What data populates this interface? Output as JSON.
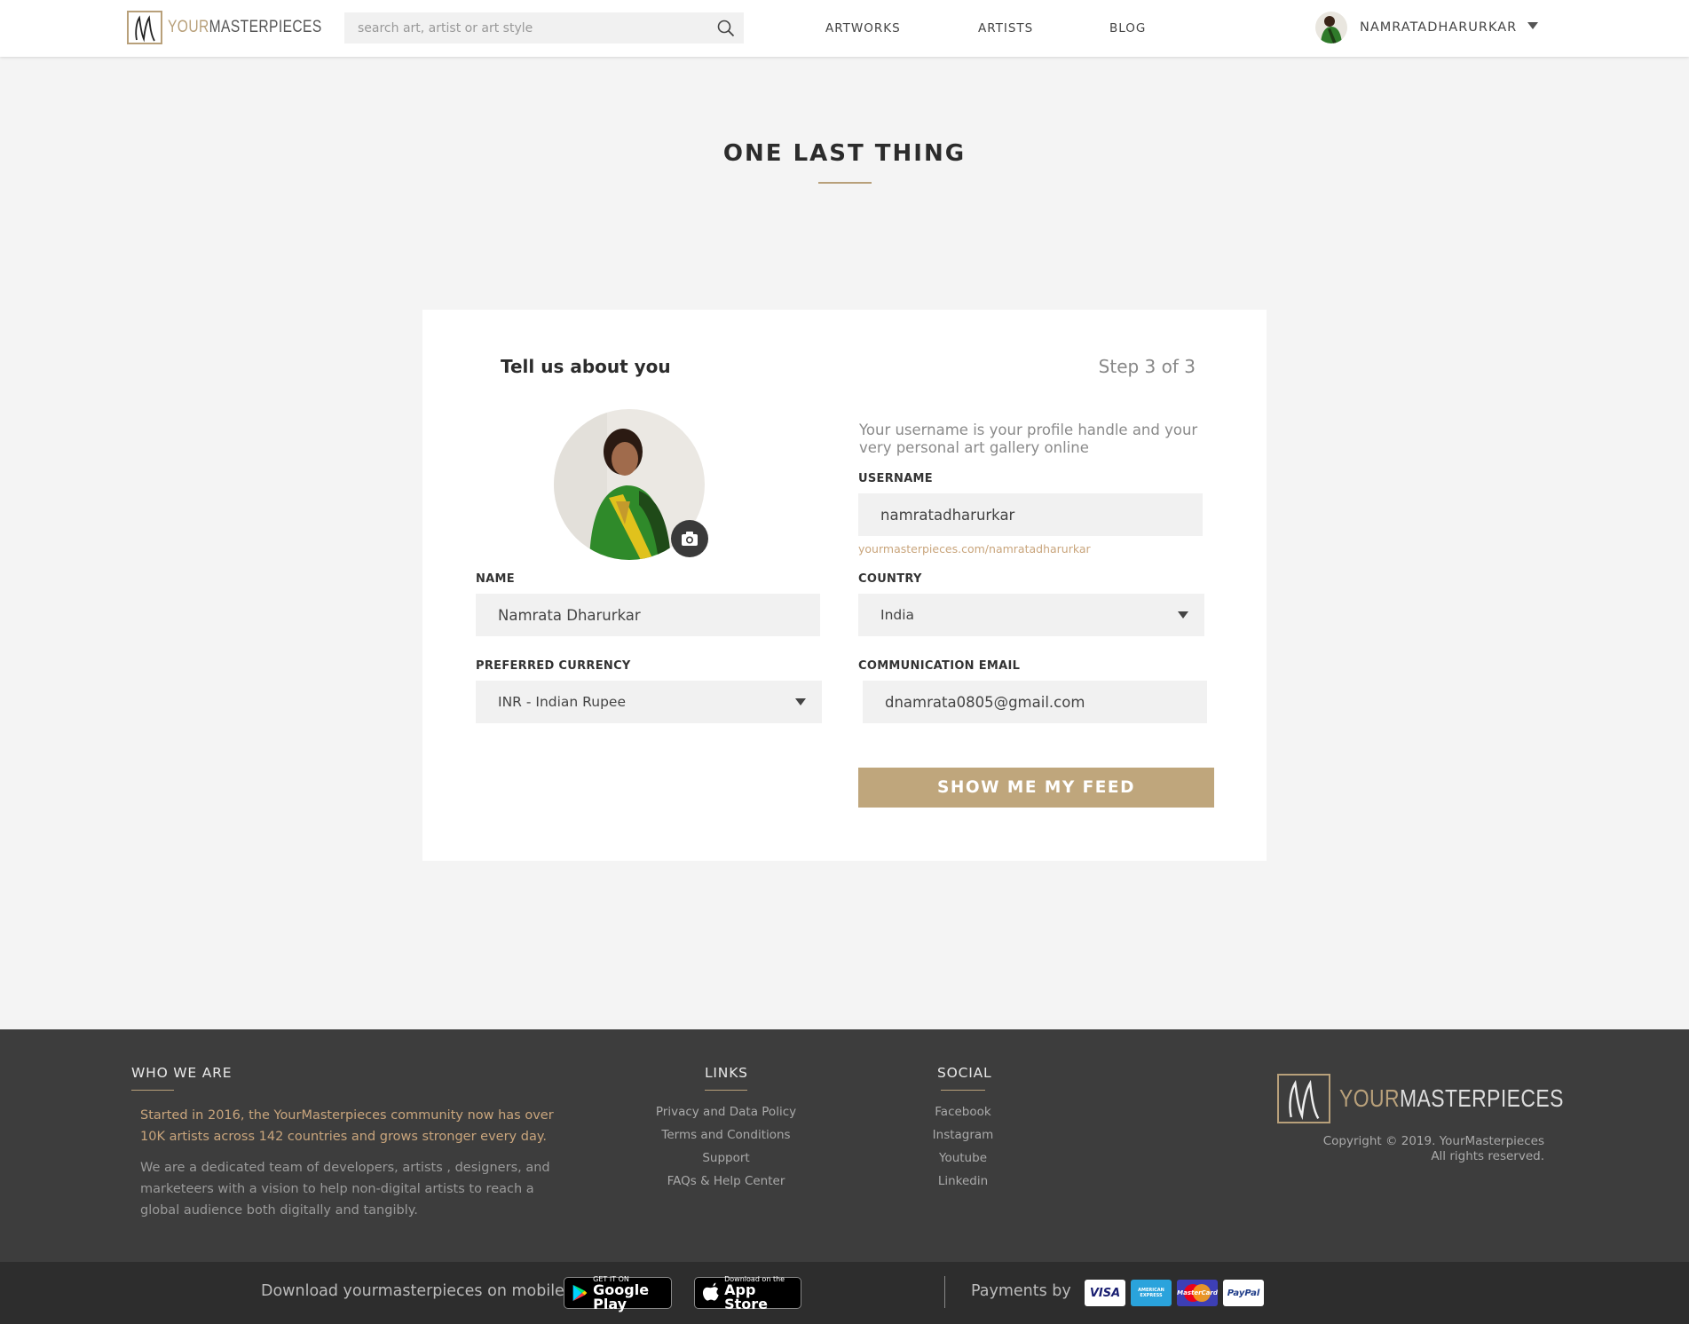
{
  "header": {
    "logo": {
      "your": "YOUR",
      "master": "MASTERPIECES"
    },
    "search_placeholder": "search art, artist or art style",
    "nav": {
      "artworks": "ARTWORKS",
      "artists": "ARTISTS",
      "blog": "BLOG"
    },
    "username": "NAMRATADHARURKAR"
  },
  "page": {
    "title": "ONE LAST THING"
  },
  "card": {
    "heading": "Tell us about you",
    "step": "Step 3 of 3",
    "hint": "Your username is your profile handle and your very personal art gallery online",
    "fields": {
      "username_label": "USERNAME",
      "username_value": "namratadharurkar",
      "url_hint": "yourmasterpieces.com/namratadharurkar",
      "name_label": "NAME",
      "name_value": "Namrata Dharurkar",
      "country_label": "COUNTRY",
      "country_value": "India",
      "currency_label": "PREFERRED CURRENCY",
      "currency_value": "INR - Indian Rupee",
      "email_label": "COMMUNICATION EMAIL",
      "email_value": "dnamrata0805@gmail.com"
    },
    "cta": "SHOW ME MY FEED"
  },
  "footer": {
    "who_heading": "WHO WE ARE",
    "who_text_1": "Started in 2016, the YourMasterpieces community now has over 10K artists across 142 countries and grows stronger every day.",
    "who_text_2": "We are a dedicated team of developers, artists , designers, and marketeers with a vision to help non-digital artists to reach a global audience both digitally and tangibly.",
    "links_heading": "LINKS",
    "links": [
      "Privacy and Data Policy",
      "Terms and Conditions",
      "Support",
      "FAQs & Help Center"
    ],
    "social_heading": "SOCIAL",
    "social": [
      "Facebook",
      "Instagram",
      "Youtube",
      "Linkedin"
    ],
    "logo": {
      "your": "YOUR",
      "master": "MASTERPIECES"
    },
    "copyright_1": "Copyright © 2019. YourMasterpieces",
    "copyright_2": "All rights reserved."
  },
  "bottom_bar": {
    "download_text": "Download yourmasterpieces on mobile",
    "google_small": "GET IT ON",
    "google_big": "Google Play",
    "apple_small": "Download on the",
    "apple_big": "App Store",
    "payments_text": "Payments by",
    "payment_methods": [
      "VISA",
      "AMERICAN EXPRESS",
      "MasterCard",
      "PayPal"
    ]
  },
  "colors": {
    "accent": "#bfa67c",
    "footer_bg": "#3d3d3d",
    "bottom_bg": "#2d2d2d"
  }
}
